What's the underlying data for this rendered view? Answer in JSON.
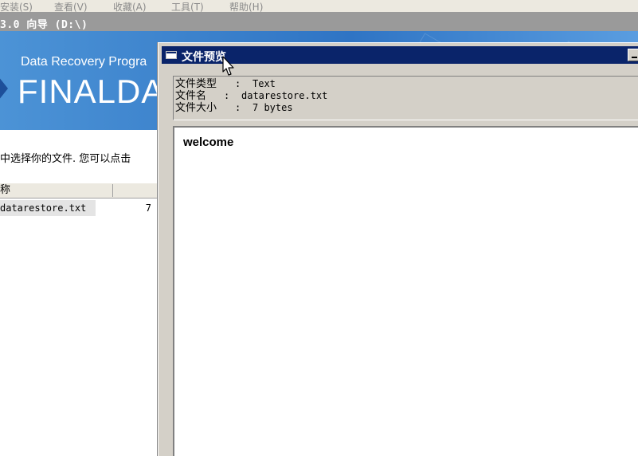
{
  "menubar": {
    "items": [
      "安装(S)",
      "查看(V)",
      "收藏(A)",
      "工具(T)",
      "帮助(H)"
    ]
  },
  "main_window": {
    "title": "3.0 向导 (D:\\)",
    "banner_subtitle": "Data Recovery Progra",
    "banner_brand": "FINALDA",
    "instruction": "中选择你的文件.  您可以点击",
    "list_header": {
      "name_label": "称"
    },
    "files": [
      {
        "name": "datarestore.txt",
        "size": "7"
      }
    ],
    "colors": {
      "banner": "#2f74c4",
      "titlebar": "#9a9a9a"
    }
  },
  "preview_dialog": {
    "title": "文件预览",
    "info": {
      "type_label": "文件类型",
      "type_sep": ":",
      "type_value": "Text",
      "name_label": "文件名",
      "name_sep": ":",
      "name_value": "datarestore.txt",
      "size_label": "文件大小",
      "size_sep": ":",
      "size_value": "7 bytes"
    },
    "content": "welcome",
    "colors": {
      "titlebar": "#0a246a",
      "dialog_bg": "#d4d0c8"
    }
  },
  "icons": {
    "dialog_icon": "window-icon",
    "minimize": "minimize-icon",
    "cursor": "mouse-pointer-icon",
    "logo": "diamond-logo-icon"
  }
}
